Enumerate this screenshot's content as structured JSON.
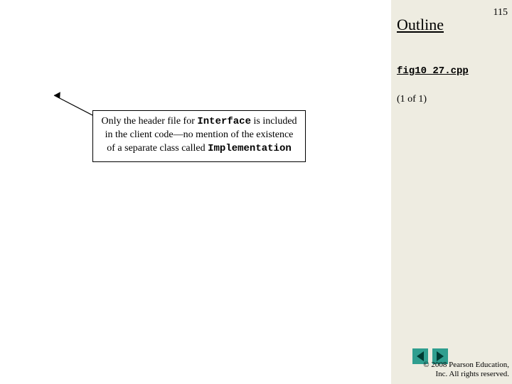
{
  "header": {
    "outline": "Outline",
    "page_number": "115"
  },
  "file": {
    "name": "fig10_27.cpp",
    "page_of": "(1 of 1)"
  },
  "callout": {
    "part1": "Only the header file for ",
    "code1": "Interface",
    "part2": " is included in the client code—no mention of the existence of a separate class called ",
    "code2": "Implementation"
  },
  "footer": {
    "copyright_line1": "© 2008 Pearson Education,",
    "copyright_line2": "Inc.  All rights reserved."
  }
}
